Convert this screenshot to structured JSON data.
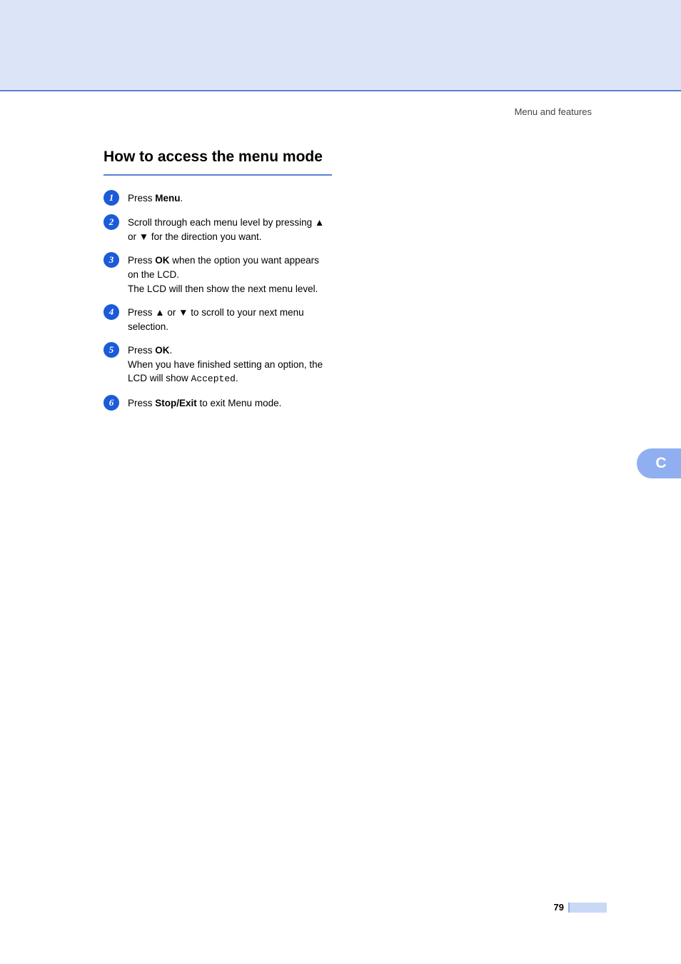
{
  "header": {
    "breadcrumb": "Menu and features"
  },
  "section": {
    "title": "How to access the menu mode"
  },
  "steps": [
    {
      "num": "1",
      "prefix": "Press ",
      "bold": "Menu",
      "suffix": "."
    },
    {
      "num": "2",
      "prefix": "Scroll through each menu level by pressing ",
      "sym1": "▲",
      "mid1": " or ",
      "sym2": "▼",
      "suffix": " for the direction you want."
    },
    {
      "num": "3",
      "prefix": "Press ",
      "bold": "OK",
      "suffix": " when the option you want appears on the LCD.",
      "line2": "The LCD will then show the next menu level."
    },
    {
      "num": "4",
      "prefix": "Press ",
      "sym1": "▲",
      "mid1": " or ",
      "sym2": "▼",
      "suffix": " to scroll to your next menu selection."
    },
    {
      "num": "5",
      "prefix": "Press ",
      "bold": "OK",
      "suffix": ".",
      "line2_prefix": "When you have finished setting an option, the LCD will show ",
      "line2_mono": "Accepted",
      "line2_suffix": "."
    },
    {
      "num": "6",
      "prefix": "Press ",
      "bold": "Stop/Exit",
      "suffix": " to exit Menu mode."
    }
  ],
  "sideTab": {
    "letter": "C"
  },
  "footer": {
    "pageNumber": "79"
  }
}
